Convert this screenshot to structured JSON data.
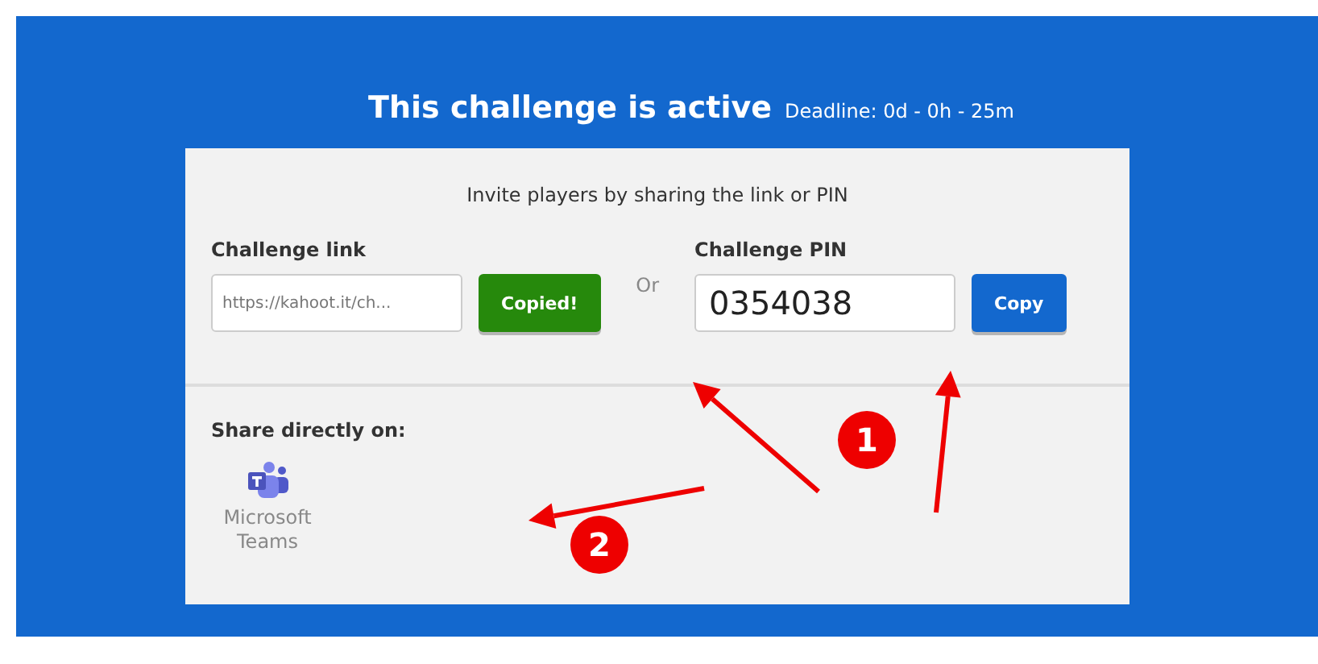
{
  "header": {
    "title": "This challenge is active",
    "deadline": "Deadline: 0d - 0h - 25m"
  },
  "card": {
    "instruction": "Invite players by sharing the link or PIN",
    "link": {
      "label": "Challenge link",
      "value": "https://kahoot.it/ch...",
      "button": "Copied!",
      "copied": true
    },
    "separator": "Or",
    "pin": {
      "label": "Challenge PIN",
      "value": "0354038",
      "button": "Copy"
    },
    "share": {
      "heading": "Share directly on:",
      "services": [
        {
          "name": "Microsoft Teams"
        }
      ]
    }
  },
  "markers": [
    "1",
    "2"
  ]
}
